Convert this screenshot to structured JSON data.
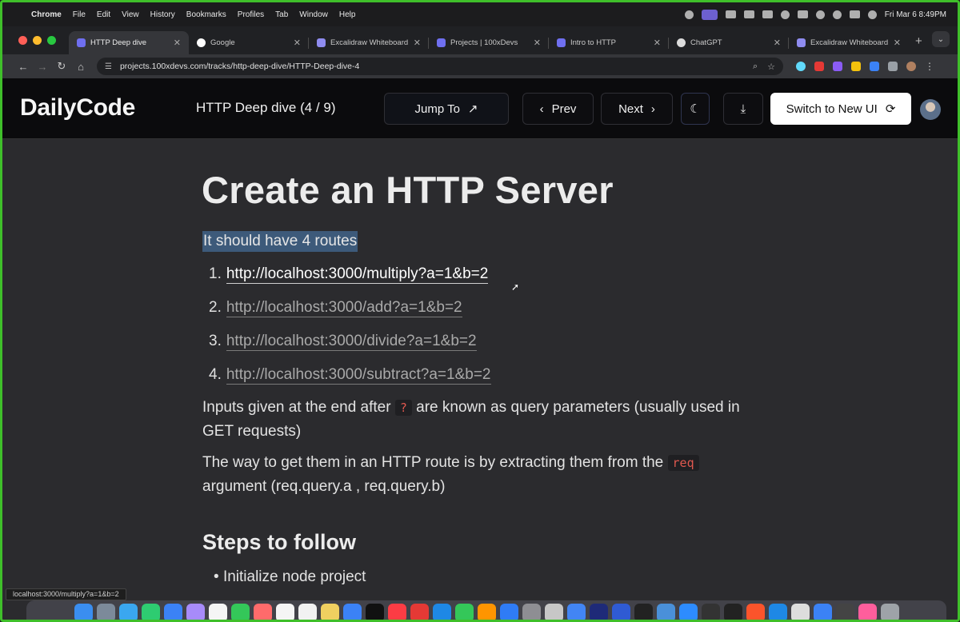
{
  "menubar": {
    "app": "Chrome",
    "items": [
      "File",
      "Edit",
      "View",
      "History",
      "Bookmarks",
      "Profiles",
      "Tab",
      "Window",
      "Help"
    ],
    "clock": "Fri Mar 6  8:49PM"
  },
  "tabs": [
    {
      "label": "HTTP Deep dive",
      "color": "#6f6ff0",
      "active": true
    },
    {
      "label": "Google",
      "color": "#ffffff"
    },
    {
      "label": "Excalidraw Whiteboard",
      "color": "#8f8cf0"
    },
    {
      "label": "Projects | 100xDevs",
      "color": "#6f6ff0"
    },
    {
      "label": "Intro to HTTP",
      "color": "#6f6ff0"
    },
    {
      "label": "ChatGPT",
      "color": "#dcdcdc"
    },
    {
      "label": "Excalidraw Whiteboard",
      "color": "#8f8cf0"
    }
  ],
  "toolbar": {
    "url": "projects.100xdevs.com/tracks/http-deep-dive/HTTP-Deep-dive-4"
  },
  "header": {
    "logo": "DailyCode",
    "course_title": "HTTP Deep dive (4 / 9)",
    "jump_label": "Jump To",
    "prev_label": "Prev",
    "next_label": "Next",
    "switch_label": "Switch to New UI"
  },
  "content": {
    "title": "Create an HTTP Server",
    "intro": "It should have 4 routes",
    "routes": [
      {
        "num": "1.",
        "url": "http://localhost:3000/multiply?a=1&b=2"
      },
      {
        "num": "2.",
        "url": "http://localhost:3000/add?a=1&b=2"
      },
      {
        "num": "3.",
        "url": "http://localhost:3000/divide?a=1&b=2"
      },
      {
        "num": "4.",
        "url": "http://localhost:3000/subtract?a=1&b=2"
      }
    ],
    "para1_a": "Inputs given at the end after",
    "para1_code": "?",
    "para1_b": "are known as query parameters (usually used in GET requests)",
    "para2_a": "The way to get them in an HTTP route is by extracting them from the",
    "para2_code": "req",
    "para2_b": "argument (req.query.a , req.query.b)",
    "steps_heading": "Steps to follow",
    "step1": "Initialize node project"
  },
  "status_url": "localhost:3000/multiply?a=1&b=2",
  "dock_colors": [
    "#3a8ef0",
    "#7c8a9a",
    "#3aa7f0",
    "#2ecc71",
    "#3b82f6",
    "#a78bfa",
    "#f5f5f5",
    "#34c759",
    "#ff6b6b",
    "#f5f5f5",
    "#f2f2f2",
    "#f0d060",
    "#3b82f6",
    "#111111",
    "#fc3c44",
    "#e53935",
    "#1e88e5",
    "#34c759",
    "#ff9500",
    "#2f7cf6",
    "#8e8e93",
    "#c7c7c7",
    "#4285f4",
    "#1e2a78",
    "#2f5bd3",
    "#222",
    "#4a90d9",
    "#2d8cff",
    "#333",
    "#222",
    "#fb542b",
    "#1e88e5",
    "#ddd",
    "#3b82f6",
    "#444",
    "#ff5e9c",
    "#9ea3a8"
  ]
}
